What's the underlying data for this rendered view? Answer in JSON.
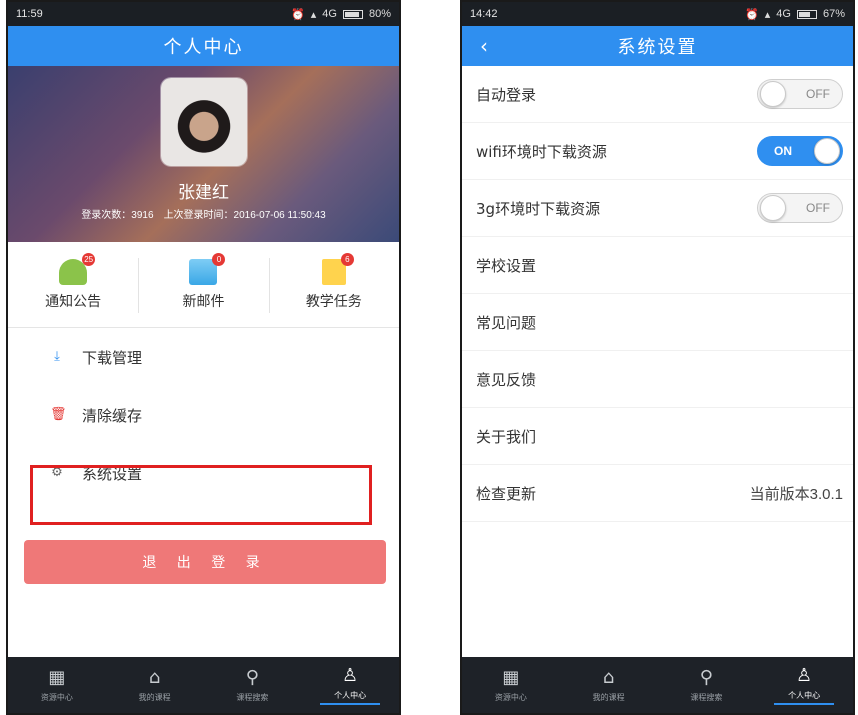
{
  "left": {
    "status": {
      "time": "11:59",
      "network": "4G",
      "battery": "80%"
    },
    "title": "个人中心",
    "profile": {
      "name": "张建红",
      "login_count": "登录次数：3916",
      "last_login": "上次登录时间：2016-07-06 11:50:43"
    },
    "quick": [
      {
        "label": "通知公告",
        "badge": "25"
      },
      {
        "label": "新邮件",
        "badge": "0"
      },
      {
        "label": "教学任务",
        "badge": "6"
      }
    ],
    "menu": [
      {
        "label": "下载管理",
        "icon": "⤓"
      },
      {
        "label": "清除缓存",
        "icon": "🗑"
      },
      {
        "label": "系统设置",
        "icon": "⚙"
      }
    ],
    "logout": "退 出 登 录",
    "tabs": [
      {
        "label": "资源中心",
        "icon": "▦"
      },
      {
        "label": "我的课程",
        "icon": "⌂"
      },
      {
        "label": "课程搜索",
        "icon": "⚲"
      },
      {
        "label": "个人中心",
        "icon": "♙"
      }
    ]
  },
  "right": {
    "status": {
      "time": "14:42",
      "network": "4G",
      "battery": "67%"
    },
    "back": "‹",
    "title": "系统设置",
    "rows": [
      {
        "label": "自动登录",
        "toggle": "OFF"
      },
      {
        "label": "wifi环境时下载资源",
        "toggle": "ON"
      },
      {
        "label": "3g环境时下载资源",
        "toggle": "OFF"
      },
      {
        "label": "学校设置"
      },
      {
        "label": "常见问题"
      },
      {
        "label": "意见反馈"
      },
      {
        "label": "关于我们"
      },
      {
        "label": "检查更新",
        "value": "当前版本3.0.1"
      }
    ],
    "tabs": [
      {
        "label": "资源中心",
        "icon": "▦"
      },
      {
        "label": "我的课程",
        "icon": "⌂"
      },
      {
        "label": "课程搜索",
        "icon": "⚲"
      },
      {
        "label": "个人中心",
        "icon": "♙"
      }
    ]
  },
  "colors": {
    "accent": "#2f8ff0",
    "logout": "#ef7878",
    "highlight": "#e02020",
    "tabbar": "#1e2228"
  }
}
